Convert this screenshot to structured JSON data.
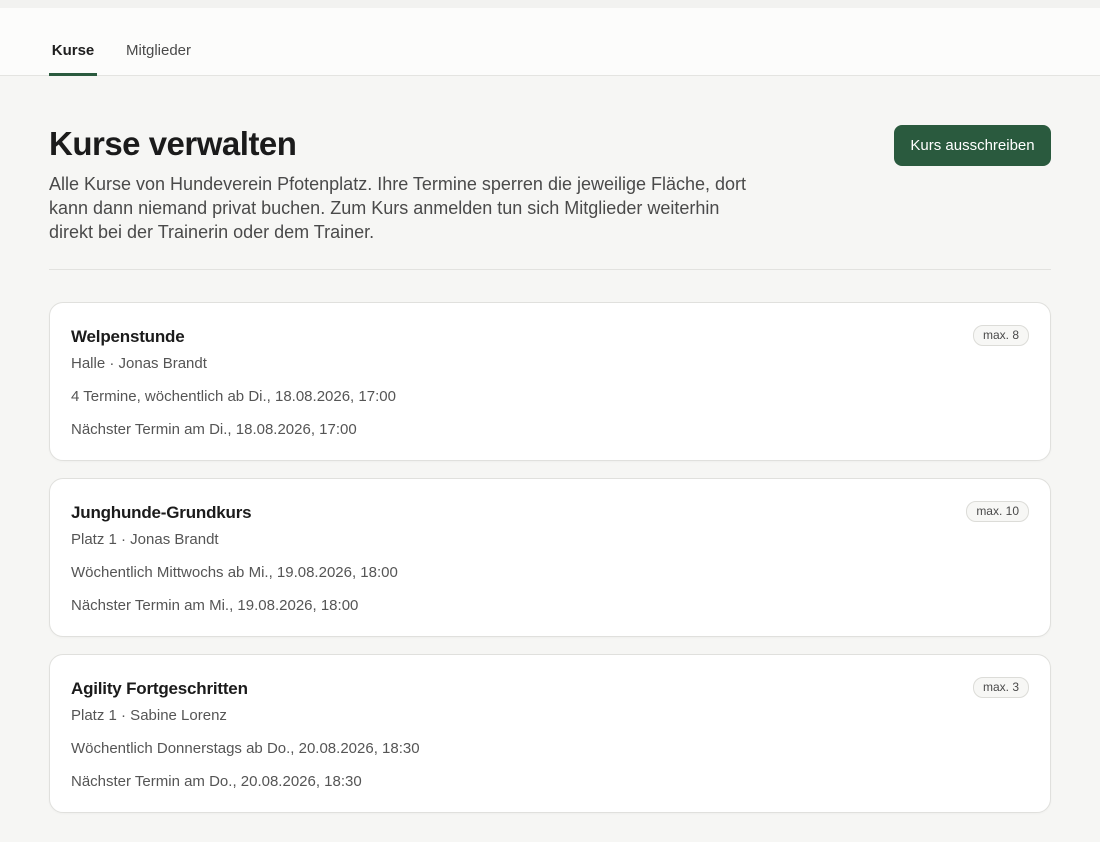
{
  "nav": {
    "tabs": [
      {
        "label": "Kurse",
        "active": true
      },
      {
        "label": "Mitglieder",
        "active": false
      }
    ]
  },
  "header": {
    "title": "Kurse verwalten",
    "description": "Alle Kurse von Hundeverein Pfotenplatz. Ihre Termine sperren die jeweilige Fläche, dort kann dann niemand privat buchen. Zum Kurs anmelden tun sich Mitglieder weiterhin direkt bei der Trainerin oder dem Trainer.",
    "action_label": "Kurs ausschreiben"
  },
  "courses": [
    {
      "name": "Welpenstunde",
      "meta": "Halle · Jonas Brandt",
      "schedule": "4 Termine, wöchentlich ab Di., 18.08.2026, 17:00",
      "next": "Nächster Termin am Di., 18.08.2026, 17:00",
      "capacity": "max. 8"
    },
    {
      "name": "Junghunde-Grundkurs",
      "meta": "Platz 1 · Jonas Brandt",
      "schedule": "Wöchentlich Mittwochs ab Mi., 19.08.2026, 18:00",
      "next": "Nächster Termin am Mi., 19.08.2026, 18:00",
      "capacity": "max. 10"
    },
    {
      "name": "Agility Fortgeschritten",
      "meta": "Platz 1 · Sabine Lorenz",
      "schedule": "Wöchentlich Donnerstags ab Do., 20.08.2026, 18:30",
      "next": "Nächster Termin am Do., 20.08.2026, 18:30",
      "capacity": "max. 3"
    }
  ],
  "colors": {
    "accent": "#2a5a3e",
    "background": "#f6f6f4",
    "card": "#ffffff"
  }
}
